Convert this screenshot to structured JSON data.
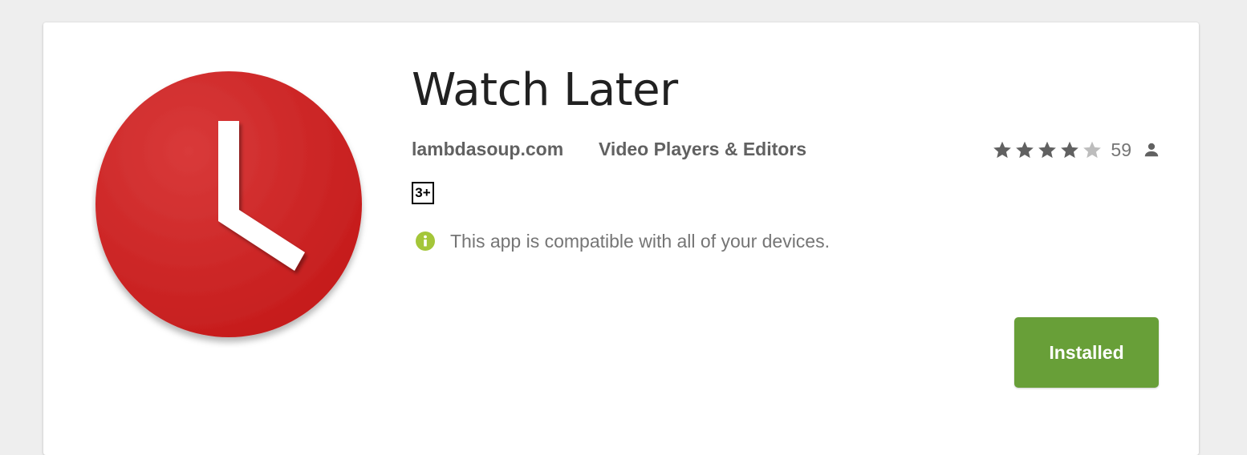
{
  "app": {
    "title": "Watch Later",
    "developer": "lambdasoup.com",
    "category": "Video Players & Editors",
    "content_rating": "3+",
    "compatibility": "This app is compatible with all of your devices.",
    "install_button_label": "Installed",
    "icon": "clock-icon"
  },
  "rating": {
    "stars_filled": 4,
    "stars_total": 5,
    "count": "59",
    "count_icon": "person-icon"
  },
  "colors": {
    "install_button": "#689f38",
    "app_icon_red": "#d32f2f",
    "info_icon": "#a4c639",
    "star_filled": "#616161",
    "star_empty": "#bdbdbd"
  }
}
